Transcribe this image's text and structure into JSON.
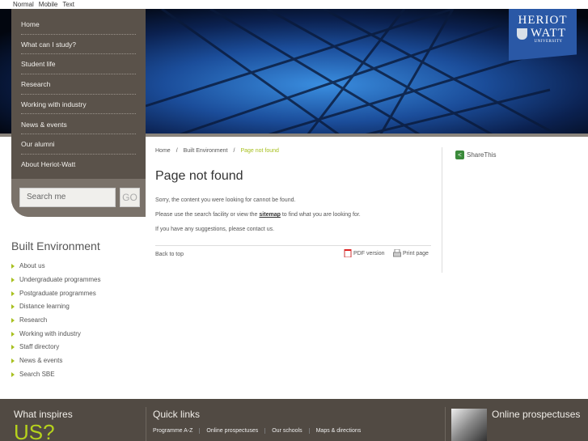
{
  "topbar": {
    "links": [
      "Normal",
      "Mobile",
      "Text"
    ]
  },
  "logo": {
    "line1": "HERIOT",
    "line2": "WATT",
    "line3": "UNIVERSITY"
  },
  "nav": {
    "items": [
      "Home",
      "What can I study?",
      "Student life",
      "Research",
      "Working with industry",
      "News & events",
      "Our alumni",
      "About Heriot-Watt"
    ],
    "search_placeholder": "Search me",
    "go_label": "GO"
  },
  "breadcrumb": {
    "items": [
      "Home",
      "Built Environment"
    ],
    "separator": "/",
    "current": "Page not found"
  },
  "main": {
    "title": "Page not found",
    "p1": "Sorry, the content you were looking for cannot be found.",
    "p2_before": "Please use the search facility or view the ",
    "p2_link": "sitemap",
    "p2_after": " to find what you are looking for.",
    "p3": "If you have any suggestions, please contact us.",
    "back_to_top": "Back to top",
    "pdf": "PDF version",
    "print": "Print page"
  },
  "share": {
    "label": "ShareThis"
  },
  "section": {
    "title": "Built Environment",
    "items": [
      "About us",
      "Undergraduate programmes",
      "Postgraduate programmes",
      "Distance learning",
      "Research",
      "Working with industry",
      "Staff directory",
      "News & events",
      "Search SBE"
    ]
  },
  "footer": {
    "inspire1": "What inspires",
    "inspire2": "US?",
    "quick_title": "Quick links",
    "quick_links": [
      "Programme A-Z",
      "Online prospectuses",
      "Our schools",
      "Maps & directions"
    ],
    "prospectus_title": "Online prospectuses"
  },
  "colors": {
    "accent": "#a8c020",
    "nav_bg": "#5a524a",
    "footer_bg": "#514a43",
    "logo_blue": "#2a58a6"
  }
}
